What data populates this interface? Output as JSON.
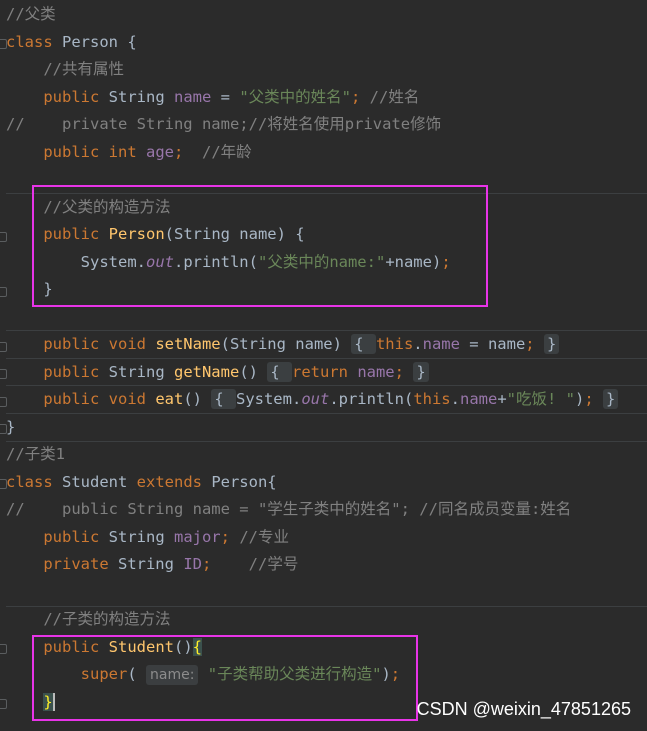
{
  "lines": [
    {
      "id": "l1",
      "segs": [
        [
          "cm",
          "//父类"
        ]
      ]
    },
    {
      "id": "l2",
      "segs": [
        [
          "kw",
          "class "
        ],
        [
          "plain",
          "Person {"
        ]
      ]
    },
    {
      "id": "l3",
      "segs": [
        [
          "plain",
          "    "
        ],
        [
          "cm",
          "//共有属性"
        ]
      ]
    },
    {
      "id": "l4",
      "segs": [
        [
          "plain",
          "    "
        ],
        [
          "kw",
          "public "
        ],
        [
          "plain",
          "String "
        ],
        [
          "fld",
          "name"
        ],
        [
          "plain",
          " = "
        ],
        [
          "str",
          "\"父类中的姓名\""
        ],
        [
          "kw",
          "; "
        ],
        [
          "cm",
          "//姓名"
        ]
      ]
    },
    {
      "id": "l5",
      "segs": [
        [
          "cm",
          "//    private String name;//将姓名使用private修饰"
        ]
      ]
    },
    {
      "id": "l6",
      "segs": [
        [
          "plain",
          "    "
        ],
        [
          "kw",
          "public int "
        ],
        [
          "fld",
          "age"
        ],
        [
          "kw",
          ";  "
        ],
        [
          "cm",
          "//年龄"
        ]
      ]
    },
    {
      "id": "l7",
      "segs": []
    },
    {
      "id": "l8",
      "segs": [
        [
          "plain",
          "    "
        ],
        [
          "cm",
          "//父类的构造方法"
        ]
      ]
    },
    {
      "id": "l9",
      "segs": [
        [
          "plain",
          "    "
        ],
        [
          "kw",
          "public "
        ],
        [
          "fn",
          "Person"
        ],
        [
          "plain",
          "(String name) {"
        ]
      ]
    },
    {
      "id": "l10",
      "segs": [
        [
          "plain",
          "        System."
        ],
        [
          "fld it",
          "out"
        ],
        [
          "plain",
          ".println("
        ],
        [
          "str",
          "\"父类中的name:\""
        ],
        [
          "plain",
          "+name)"
        ],
        [
          "kw",
          ";"
        ]
      ]
    },
    {
      "id": "l11",
      "segs": [
        [
          "plain",
          "    }"
        ]
      ]
    },
    {
      "id": "l12",
      "segs": []
    },
    {
      "id": "l13",
      "segs": [
        [
          "plain",
          "    "
        ],
        [
          "kw",
          "public void "
        ],
        [
          "fn",
          "setName"
        ],
        [
          "plain",
          "(String name) "
        ],
        [
          "pill",
          "{ "
        ],
        [
          "kw",
          "this"
        ],
        [
          "plain",
          "."
        ],
        [
          "fld",
          "name"
        ],
        [
          "plain",
          " = name"
        ],
        [
          "kw",
          "; "
        ],
        [
          "pill",
          "}"
        ]
      ]
    },
    {
      "id": "l14",
      "segs": [
        [
          "plain",
          "    "
        ],
        [
          "kw",
          "public "
        ],
        [
          "plain",
          "String "
        ],
        [
          "fn",
          "getName"
        ],
        [
          "plain",
          "() "
        ],
        [
          "pill",
          "{ "
        ],
        [
          "kw",
          "return "
        ],
        [
          "fld",
          "name"
        ],
        [
          "kw",
          "; "
        ],
        [
          "pill",
          "}"
        ]
      ]
    },
    {
      "id": "l15",
      "segs": [
        [
          "plain",
          "    "
        ],
        [
          "kw",
          "public void "
        ],
        [
          "fn",
          "eat"
        ],
        [
          "plain",
          "() "
        ],
        [
          "pill",
          "{ "
        ],
        [
          "plain",
          "System."
        ],
        [
          "fld it",
          "out"
        ],
        [
          "plain",
          ".println("
        ],
        [
          "kw",
          "this"
        ],
        [
          "plain",
          "."
        ],
        [
          "fld",
          "name"
        ],
        [
          "plain",
          "+"
        ],
        [
          "str",
          "\"吃饭! \""
        ],
        [
          "plain",
          ")"
        ],
        [
          "kw",
          "; "
        ],
        [
          "pill",
          "}"
        ]
      ]
    },
    {
      "id": "l16",
      "segs": [
        [
          "plain",
          "}"
        ]
      ]
    },
    {
      "id": "l17",
      "segs": [
        [
          "cm",
          "//子类1"
        ]
      ]
    },
    {
      "id": "l18",
      "segs": [
        [
          "kw",
          "class "
        ],
        [
          "plain",
          "Student "
        ],
        [
          "kw",
          "extends "
        ],
        [
          "plain",
          "Person{"
        ]
      ]
    },
    {
      "id": "l19",
      "segs": [
        [
          "cm",
          "//    public String name = \"学生子类中的姓名\"; //同名成员变量:姓名"
        ]
      ]
    },
    {
      "id": "l20",
      "segs": [
        [
          "plain",
          "    "
        ],
        [
          "kw",
          "public "
        ],
        [
          "plain",
          "String "
        ],
        [
          "fld",
          "major"
        ],
        [
          "kw",
          "; "
        ],
        [
          "cm",
          "//专业"
        ]
      ]
    },
    {
      "id": "l21",
      "segs": [
        [
          "plain",
          "    "
        ],
        [
          "kw",
          "private "
        ],
        [
          "plain",
          "String "
        ],
        [
          "fld",
          "ID"
        ],
        [
          "kw",
          ";    "
        ],
        [
          "cm",
          "//学号"
        ]
      ]
    },
    {
      "id": "l22",
      "segs": []
    },
    {
      "id": "l23",
      "segs": [
        [
          "plain",
          "    "
        ],
        [
          "cm",
          "//子类的构造方法"
        ]
      ]
    },
    {
      "id": "l24",
      "segs": [
        [
          "plain",
          "    "
        ],
        [
          "kw",
          "public "
        ],
        [
          "fn",
          "Student"
        ],
        [
          "plain",
          "()"
        ],
        [
          "brace-hl",
          "{"
        ]
      ]
    },
    {
      "id": "l25",
      "segs": [
        [
          "plain",
          "        "
        ],
        [
          "kw",
          "super"
        ],
        [
          "plain",
          "( "
        ],
        [
          "hint",
          "name:"
        ],
        [
          "plain",
          " "
        ],
        [
          "str",
          "\"子类帮助父类进行构造\""
        ],
        [
          "plain",
          ")"
        ],
        [
          "kw",
          ";"
        ]
      ]
    },
    {
      "id": "l26",
      "segs": [
        [
          "plain",
          "    "
        ],
        [
          "brace-hl",
          "}"
        ],
        [
          "caret",
          ""
        ]
      ]
    }
  ],
  "watermark": "CSDN @weixin_47851265",
  "colors": {
    "background": "#2b2b2b",
    "keyword": "#cc7832",
    "comment": "#808080",
    "string": "#6a8759",
    "field": "#9876aa",
    "method": "#ffc66d",
    "highlight_box": "#e834e8"
  }
}
